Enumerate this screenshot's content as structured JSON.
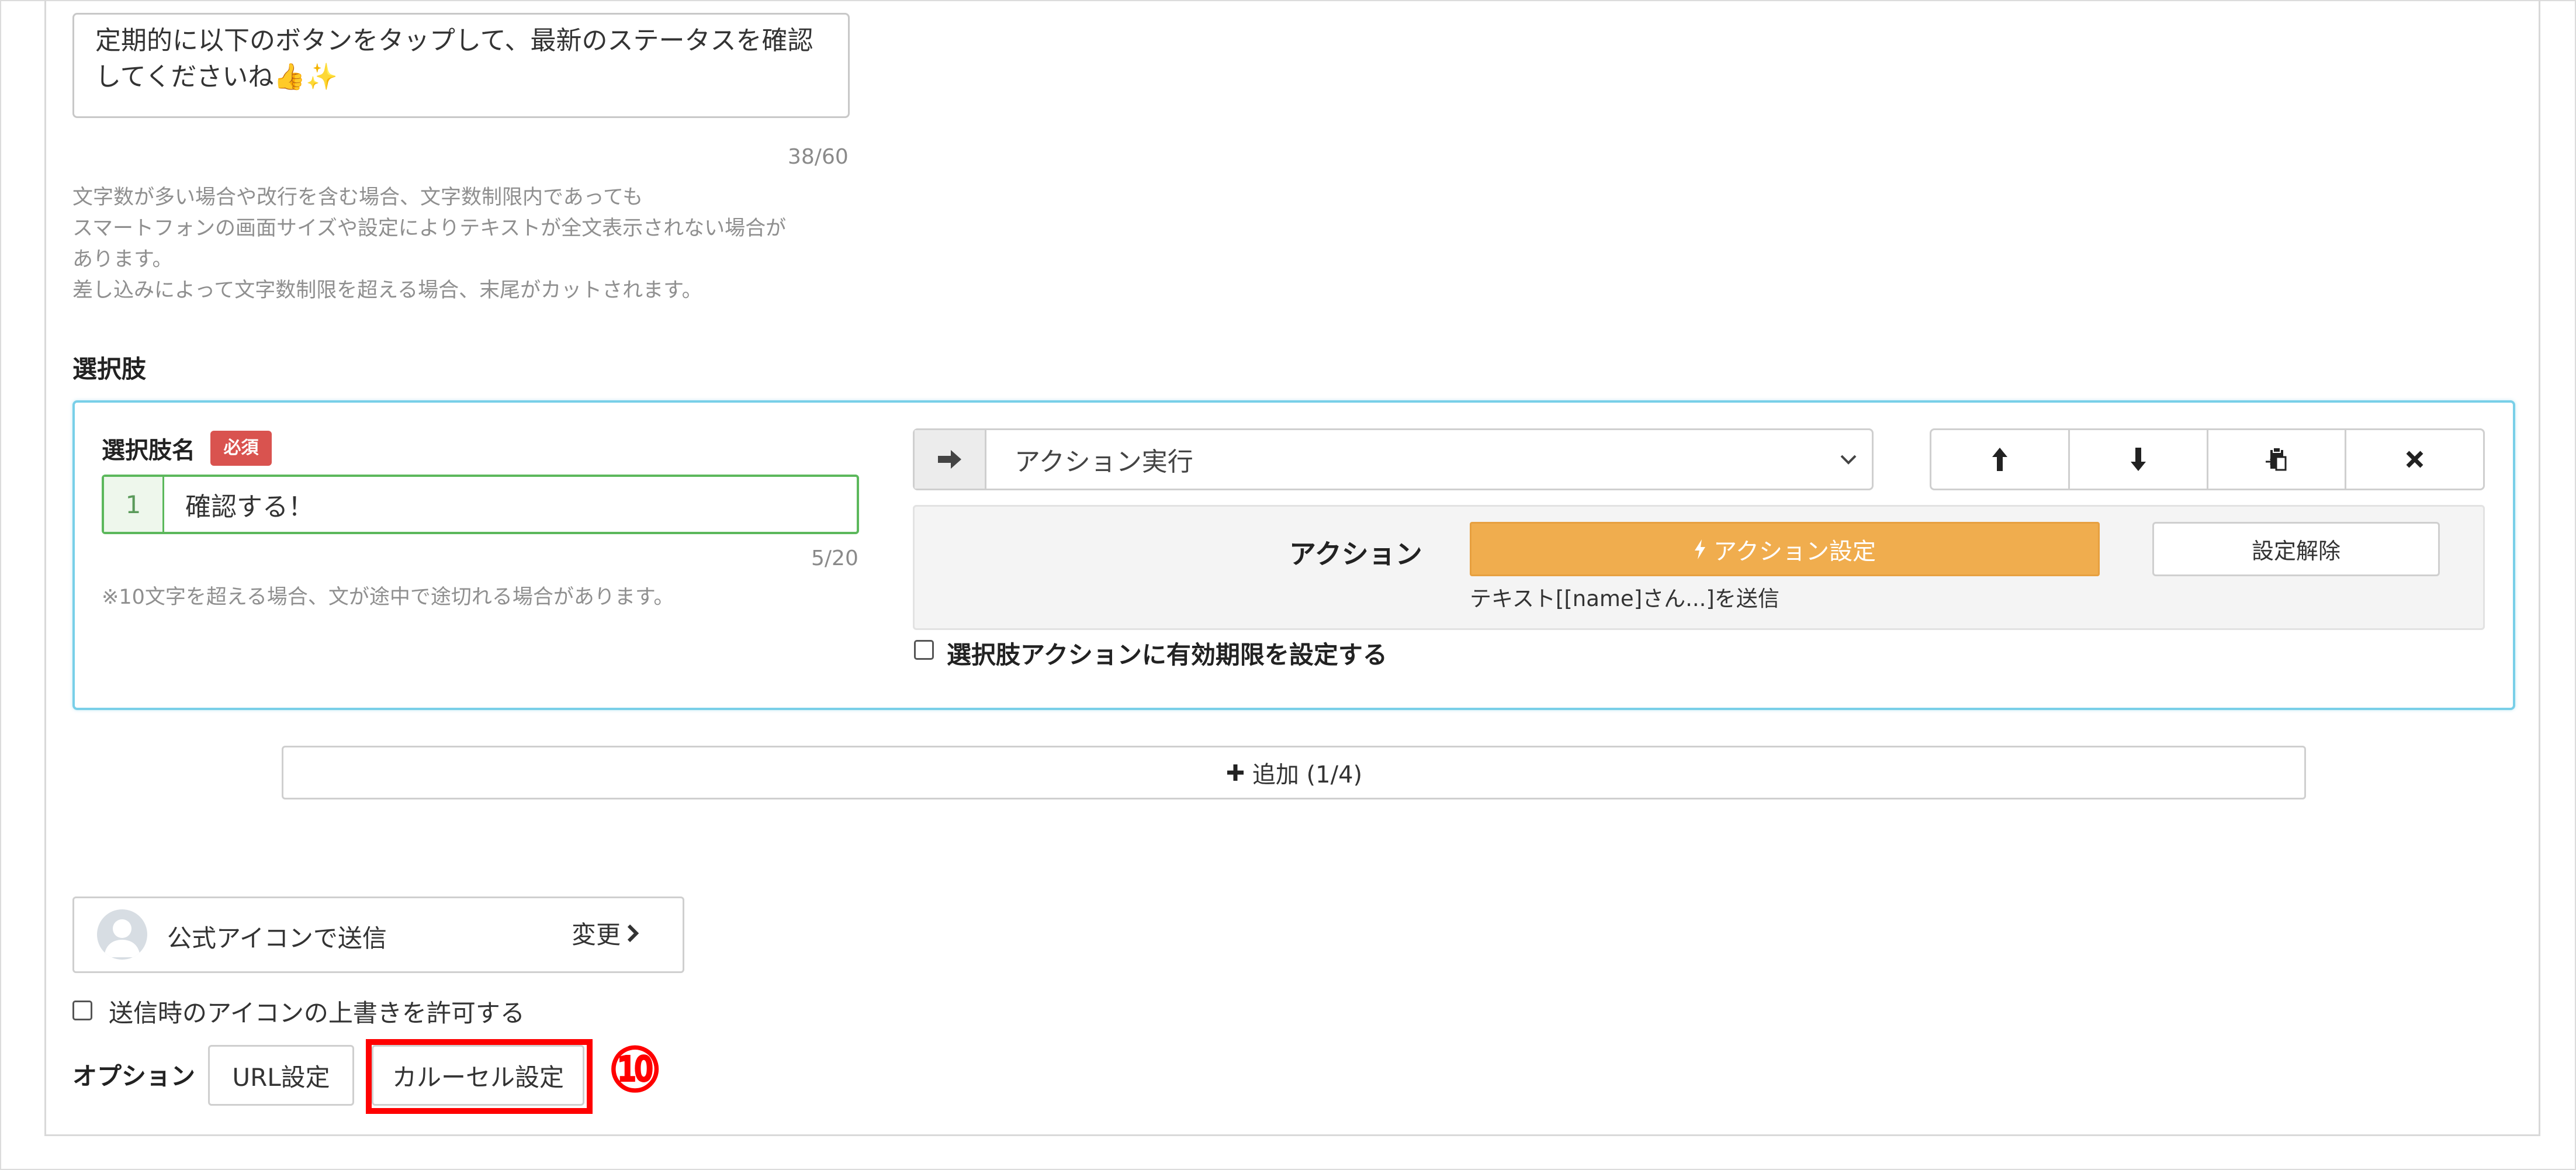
{
  "message": {
    "text": "定期的に以下のボタンをタップして、最新のステータスを確認\nしてくださいね👍✨",
    "counter": "38/60",
    "help_lines": [
      "文字数が多い場合や改行を含む場合、文字数制限内であっても",
      "スマートフォンの画面サイズや設定によりテキストが全文表示されない場合が",
      "あります。",
      "差し込みによって文字数制限を超える場合、末尾がカットされます。"
    ]
  },
  "choices": {
    "section_label": "選択肢",
    "item": {
      "name_label": "選択肢名",
      "required_badge": "必須",
      "number": "1",
      "value": "確認する！",
      "counter": "5/20",
      "note": "※10文字を超える場合、文が途中で途切れる場合があります。",
      "type_addon_icon": "arrow-right-icon",
      "type_select_value": "アクション実行",
      "move_up_icon": "arrow-up-icon",
      "move_down_icon": "arrow-down-icon",
      "copy_icon": "paste-icon",
      "remove_icon": "close-icon",
      "action_label": "アクション",
      "action_button": "アクション設定",
      "action_summary": "テキスト[[name]さん...]を送信",
      "unset_button": "設定解除",
      "expire_checkbox_label": "選択肢アクションに有効期限を設定する"
    },
    "add_button": "追加 (1/4)"
  },
  "sender": {
    "label": "公式アイコンで送信",
    "change_link": "変更",
    "override_label": "送信時のアイコンの上書きを許可する"
  },
  "options": {
    "label": "オプション",
    "url_button": "URL設定",
    "carousel_button": "カルーセル設定"
  },
  "annotation": {
    "step_number": "⑩",
    "color": "#ff0000"
  },
  "colors": {
    "action_orange": "#f0ad4e",
    "required_red": "#d9534f",
    "valid_green": "#5cb85c",
    "focus_blue": "#79cfe8"
  }
}
